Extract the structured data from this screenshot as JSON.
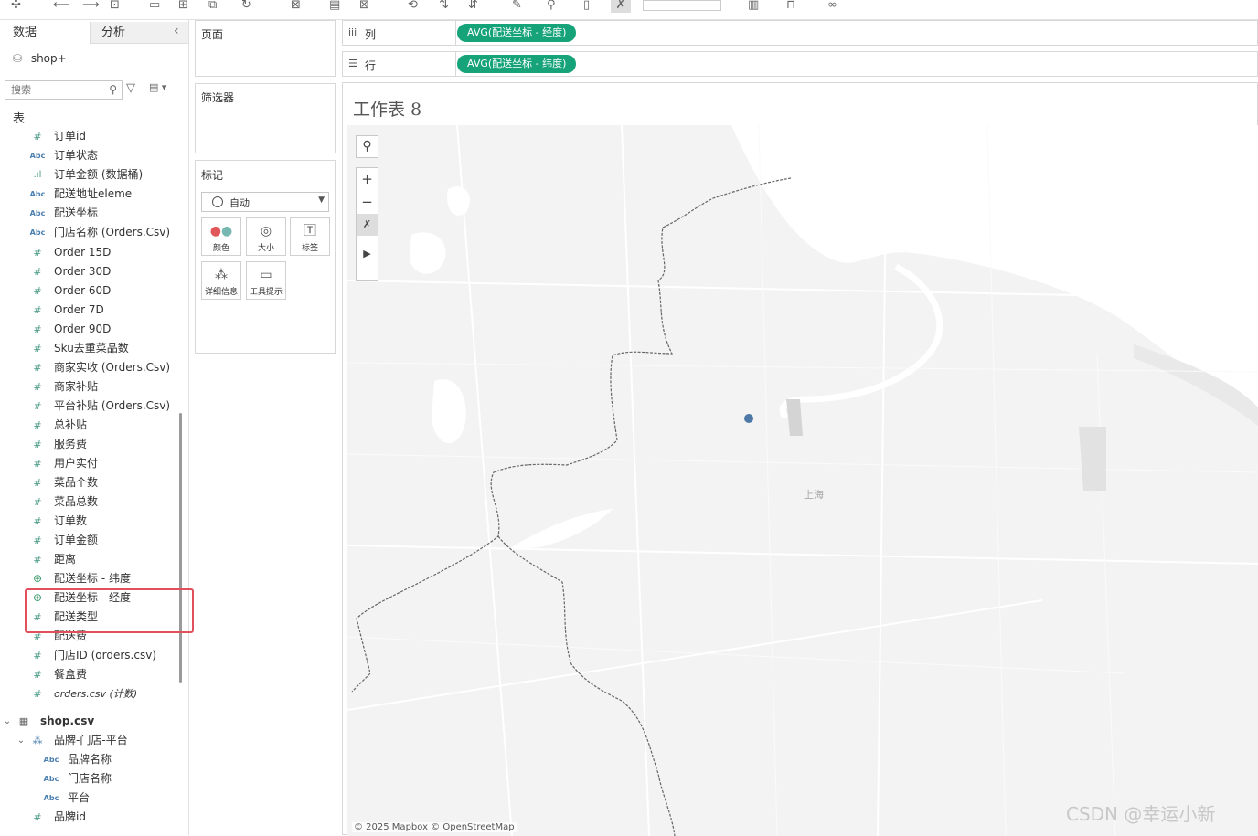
{
  "toolbar": {
    "icons": [
      "tableau-logo-icon",
      "undo-icon",
      "redo-icon",
      "new-datasource-icon",
      "save-icon",
      "new-worksheet-icon",
      "duplicate-icon",
      "clear-icon",
      "swap-icon",
      "sort-asc-icon",
      "sort-desc-icon",
      "highlight-icon",
      "group-icon",
      "label-icon",
      "fix-axes-icon",
      "show-me-icon",
      "presentation-icon",
      "share-icon"
    ]
  },
  "left_panel": {
    "tabs": {
      "data": "数据",
      "analysis": "分析"
    },
    "datasource": "shop+",
    "search_placeholder": "搜索",
    "tables_label": "表",
    "fields": [
      {
        "type": "num",
        "label": "订单id"
      },
      {
        "type": "abc",
        "label": "订单状态"
      },
      {
        "type": "bin",
        "label": "订单金额 (数据桶)"
      },
      {
        "type": "abc",
        "label": "配送地址eleme"
      },
      {
        "type": "abc",
        "label": "配送坐标"
      },
      {
        "type": "abc",
        "label": "门店名称 (Orders.Csv)"
      },
      {
        "type": "num",
        "label": "Order 15D"
      },
      {
        "type": "num",
        "label": "Order 30D"
      },
      {
        "type": "num",
        "label": "Order 60D"
      },
      {
        "type": "num",
        "label": "Order 7D"
      },
      {
        "type": "num",
        "label": "Order 90D"
      },
      {
        "type": "num",
        "label": "Sku去重菜品数"
      },
      {
        "type": "num",
        "label": "商家实收 (Orders.Csv)"
      },
      {
        "type": "num",
        "label": "商家补贴"
      },
      {
        "type": "num",
        "label": "平台补贴 (Orders.Csv)"
      },
      {
        "type": "num",
        "label": "总补贴"
      },
      {
        "type": "num",
        "label": "服务费"
      },
      {
        "type": "num",
        "label": "用户实付"
      },
      {
        "type": "num",
        "label": "菜品个数"
      },
      {
        "type": "num",
        "label": "菜品总数"
      },
      {
        "type": "num",
        "label": "订单数"
      },
      {
        "type": "num",
        "label": "订单金额"
      },
      {
        "type": "num",
        "label": "距离"
      },
      {
        "type": "geo",
        "label": "配送坐标 - 纬度"
      },
      {
        "type": "geo",
        "label": "配送坐标 - 经度"
      },
      {
        "type": "num",
        "label": "配送类型"
      },
      {
        "type": "num",
        "label": "配送费"
      },
      {
        "type": "num",
        "label": "门店ID (orders.csv)"
      },
      {
        "type": "num",
        "label": "餐盒费"
      },
      {
        "type": "num-italic",
        "label": "orders.csv (计数)"
      }
    ],
    "table2": {
      "name": "shop.csv",
      "hierarchy": "品牌-门店-平台",
      "hierarchy_fields": [
        "品牌名称",
        "门店名称",
        "平台"
      ],
      "field_after": "品牌id"
    }
  },
  "panes": {
    "pages": "页面",
    "filters": "筛选器",
    "marks": {
      "title": "标记",
      "type": "自动",
      "buttons": [
        {
          "icon": "color-icon",
          "label": "颜色"
        },
        {
          "icon": "size-icon",
          "label": "大小"
        },
        {
          "icon": "label-icon",
          "label": "标签"
        },
        {
          "icon": "detail-icon",
          "label": "详细信息"
        },
        {
          "icon": "tooltip-icon",
          "label": "工具提示"
        }
      ]
    }
  },
  "shelves": {
    "columns": {
      "label": "列",
      "pill": "AVG(配送坐标 - 经度)"
    },
    "rows": {
      "label": "行",
      "pill": "AVG(配送坐标 - 纬度)"
    }
  },
  "view": {
    "title": "工作表 8",
    "city_label": "上海",
    "attribution": "© 2025 Mapbox © OpenStreetMap",
    "point_color": "#4e79a7",
    "pill_color": "#17a37a",
    "highlight_color": "#e0515d"
  },
  "watermark": "CSDN @幸运小新"
}
